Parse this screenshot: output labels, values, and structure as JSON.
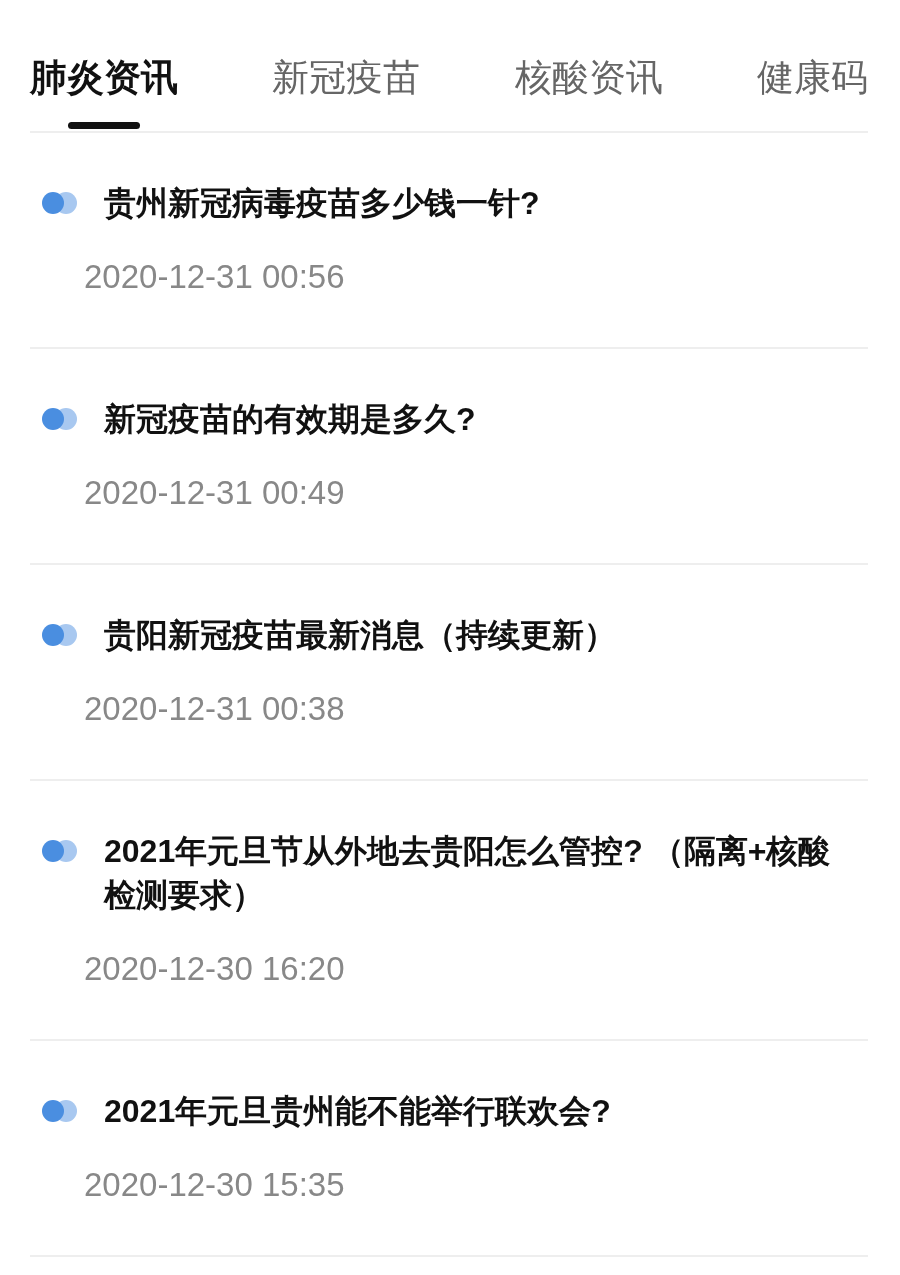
{
  "tabs": [
    {
      "label": "肺炎资讯",
      "selected": true
    },
    {
      "label": "新冠疫苗",
      "selected": false
    },
    {
      "label": "核酸资讯",
      "selected": false
    },
    {
      "label": "健康码",
      "selected": false
    }
  ],
  "articles": [
    {
      "title": "贵州新冠病毒疫苗多少钱一针?",
      "time": "2020-12-31 00:56"
    },
    {
      "title": "新冠疫苗的有效期是多久?",
      "time": "2020-12-31 00:49"
    },
    {
      "title": "贵阳新冠疫苗最新消息（持续更新）",
      "time": "2020-12-31 00:38"
    },
    {
      "title": "2021年元旦节从外地去贵阳怎么管控? （隔离+核酸检测要求）",
      "time": "2020-12-30 16:20"
    },
    {
      "title": "2021年元旦贵州能不能举行联欢会?",
      "time": "2020-12-30 15:35"
    }
  ]
}
